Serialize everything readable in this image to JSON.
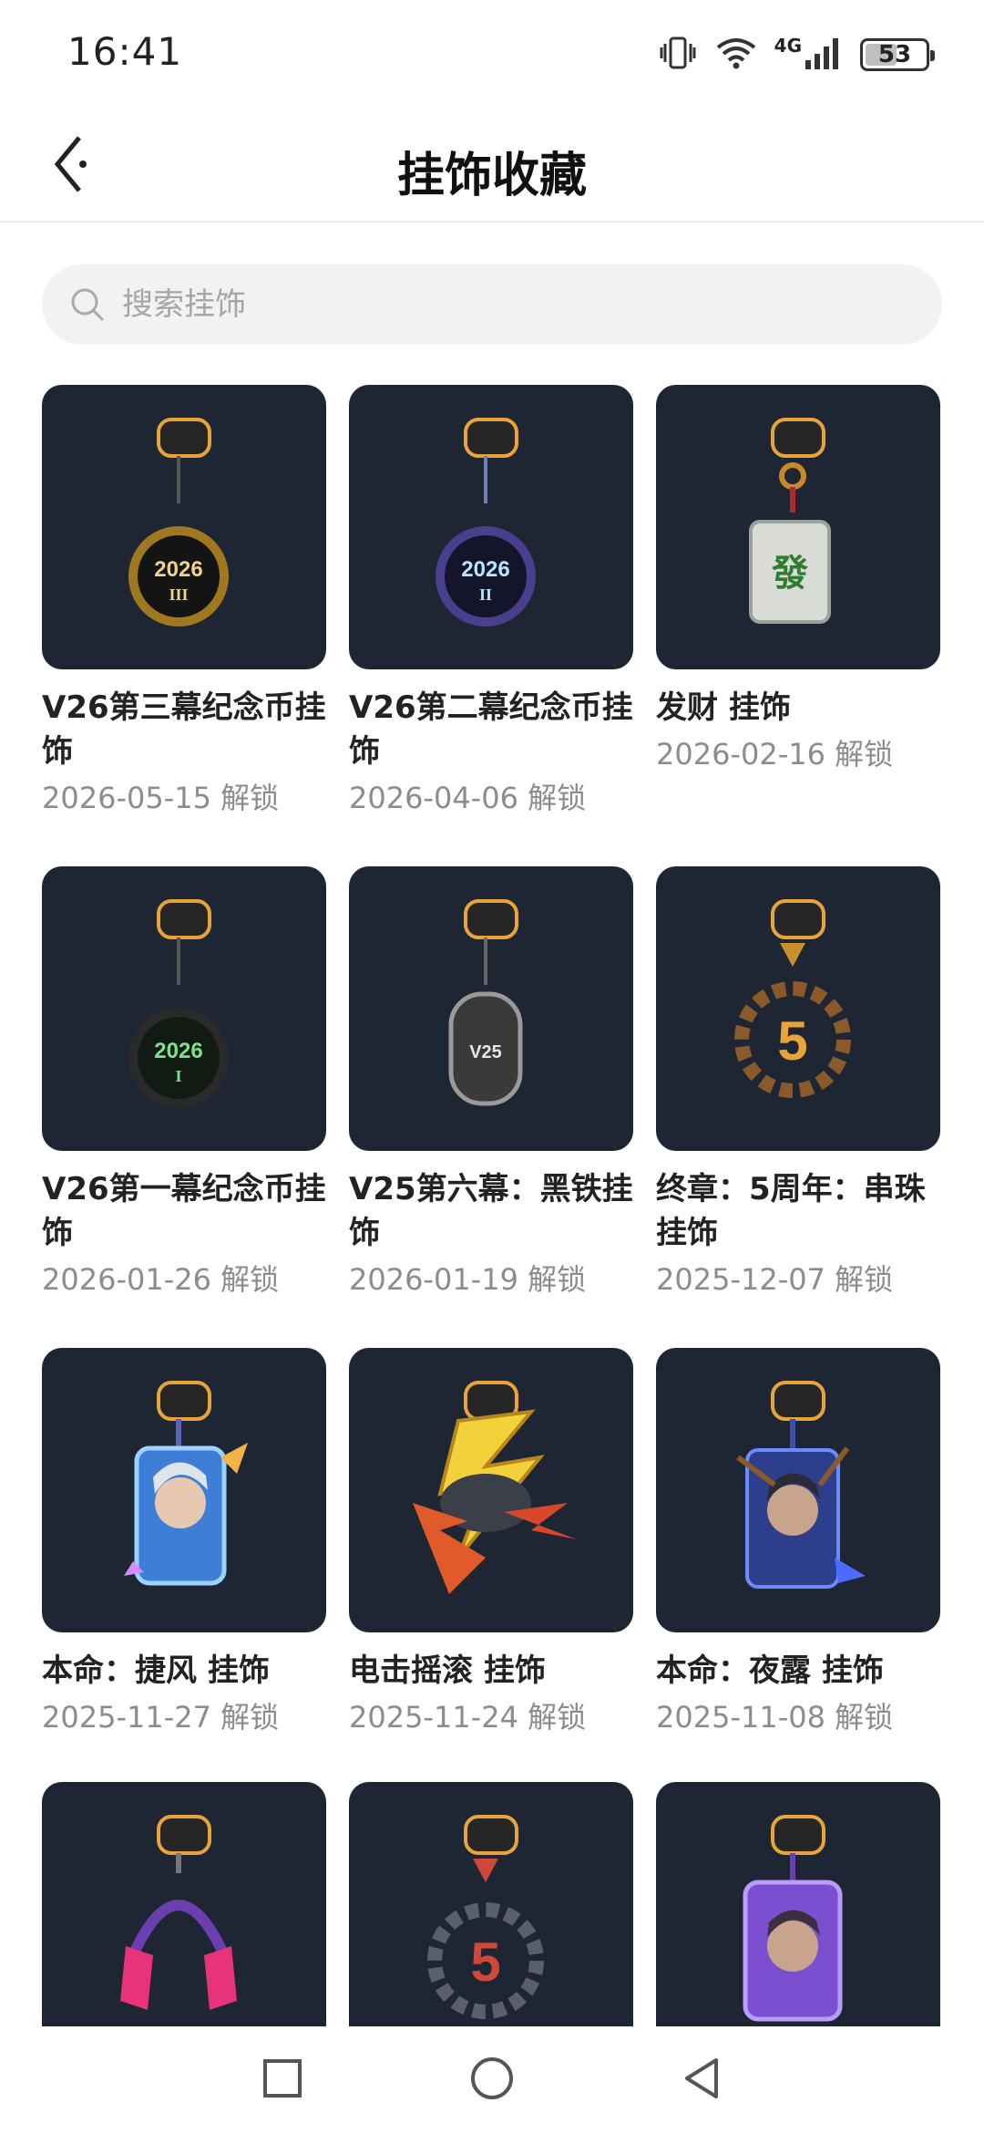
{
  "status": {
    "time": "16:41",
    "network_label": "4G",
    "battery": "53",
    "battery_level": 0.53
  },
  "header": {
    "title": "挂饰收藏",
    "back_icon": "back-arrow-icon"
  },
  "search": {
    "placeholder": "搜索挂饰",
    "value": ""
  },
  "items": [
    {
      "title": "V26第三幕纪念币挂饰",
      "date": "2026-05-15 解锁",
      "art": "coin-2026-iii"
    },
    {
      "title": "V26第二幕纪念币挂饰",
      "date": "2026-04-06 解锁",
      "art": "coin-2026-ii"
    },
    {
      "title": "发财 挂饰",
      "date": "2026-02-16 解锁",
      "art": "mahjong-fa"
    },
    {
      "title": "V26第一幕纪念币挂饰",
      "date": "2026-01-26 解锁",
      "art": "coin-2026-i"
    },
    {
      "title": "V25第六幕：黑铁挂饰",
      "date": "2026-01-19 解锁",
      "art": "iron-v25"
    },
    {
      "title": "终章：5周年：串珠挂饰",
      "date": "2025-12-07 解锁",
      "art": "beads-5-gold"
    },
    {
      "title": "本命：捷风 挂饰",
      "date": "2025-11-27 解锁",
      "art": "jett-card"
    },
    {
      "title": "电击摇滚 挂饰",
      "date": "2025-11-24 解锁",
      "art": "lightning"
    },
    {
      "title": "本命：夜露 挂饰",
      "date": "2025-11-08 解锁",
      "art": "yoru-card"
    },
    {
      "title": "",
      "date": "",
      "art": "headphones"
    },
    {
      "title": "",
      "date": "",
      "art": "beads-5-dark"
    },
    {
      "title": "",
      "date": "",
      "art": "agent-card-purple"
    }
  ],
  "colors": {
    "card_bg": "#1e2533",
    "accent_gold": "#e8a33a",
    "text_primary": "#222222",
    "text_secondary": "#8c8c8c",
    "search_bg": "#f2f2f2"
  },
  "bottom_nav": [
    "recent-apps-icon",
    "home-icon",
    "back-icon"
  ]
}
